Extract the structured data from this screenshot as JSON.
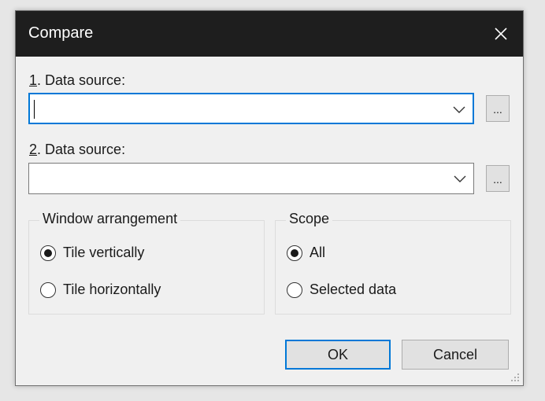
{
  "dialog": {
    "title": "Compare",
    "close_icon": "close-icon"
  },
  "source1": {
    "label_num": "1",
    "label_rest": ". Data source:",
    "value": "",
    "browse_label": "..."
  },
  "source2": {
    "label_num": "2",
    "label_rest": ". Data source:",
    "value": "",
    "browse_label": "..."
  },
  "arrangement": {
    "title": "Window arrangement",
    "options": [
      {
        "label": "Tile vertically",
        "checked": true
      },
      {
        "label": "Tile horizontally",
        "checked": false
      }
    ]
  },
  "scope": {
    "title": "Scope",
    "options": [
      {
        "label": "All",
        "checked": true
      },
      {
        "label": "Selected data",
        "checked": false
      }
    ]
  },
  "buttons": {
    "ok_label": "OK",
    "cancel_label": "Cancel"
  },
  "colors": {
    "titlebar": "#1e1e1e",
    "accent": "#0078d7",
    "dialog_bg": "#f0f0f0"
  }
}
